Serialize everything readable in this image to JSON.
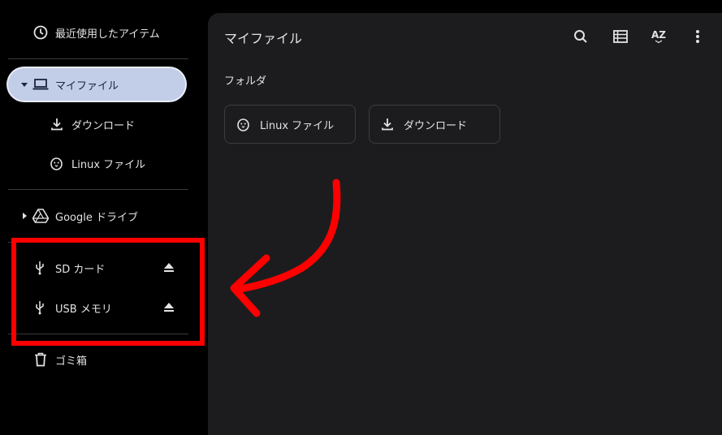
{
  "sidebar": {
    "recent": "最近使用したアイテム",
    "my_files": "マイファイル",
    "downloads": "ダウンロード",
    "linux_files": "Linux ファイル",
    "google_drive": "Google ドライブ",
    "sd_card": "SD カード",
    "usb_memory": "USB メモリ",
    "trash": "ゴミ箱"
  },
  "main": {
    "title": "マイファイル",
    "section_label": "フォルダ",
    "folders": [
      {
        "label": "Linux ファイル",
        "icon": "linux-penguin-icon"
      },
      {
        "label": "ダウンロード",
        "icon": "download-icon"
      }
    ],
    "sort_label": "AZ"
  },
  "annotation": {
    "color": "#ff0000"
  }
}
